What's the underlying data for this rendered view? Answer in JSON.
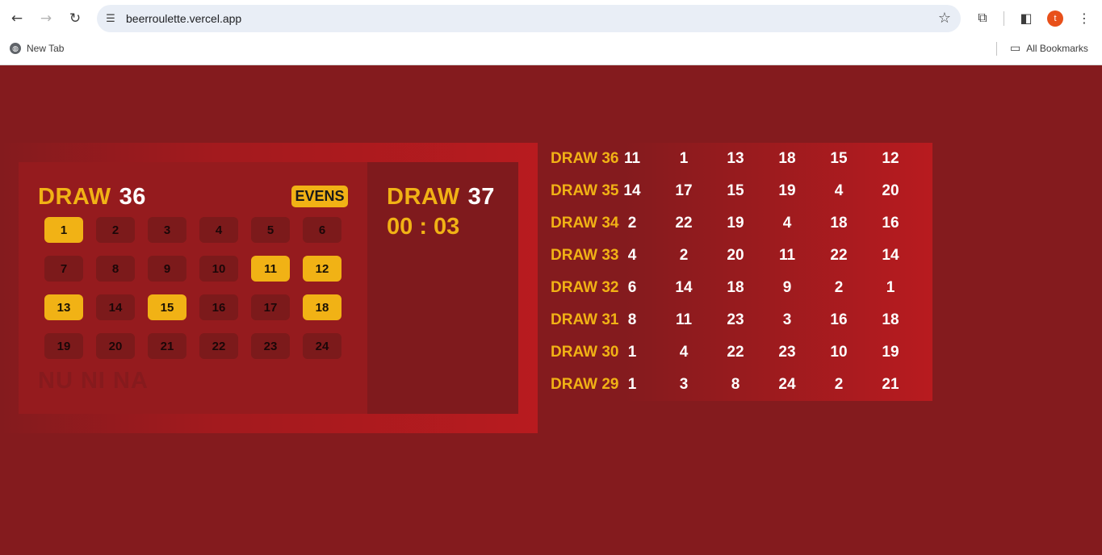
{
  "browser": {
    "url": "beerroulette.vercel.app",
    "bookmarks": [
      {
        "label": "New Tab"
      }
    ],
    "all_bookmarks_label": "All Bookmarks",
    "profile_initial": "t",
    "icons": {
      "back": "←",
      "forward": "→",
      "reload": "↻",
      "site_info": "☰",
      "star": "☆",
      "extensions": "⧉",
      "sidebar": "◧",
      "menu": "⋮",
      "globe": "◍",
      "folder": "▭"
    }
  },
  "current_draw": {
    "label": "DRAW",
    "number": "36",
    "badge": "EVENS",
    "footer_text": "NU NI NA",
    "numbers": [
      {
        "n": "1",
        "hit": true
      },
      {
        "n": "2",
        "hit": false
      },
      {
        "n": "3",
        "hit": false
      },
      {
        "n": "4",
        "hit": false
      },
      {
        "n": "5",
        "hit": false
      },
      {
        "n": "6",
        "hit": false
      },
      {
        "n": "7",
        "hit": false
      },
      {
        "n": "8",
        "hit": false
      },
      {
        "n": "9",
        "hit": false
      },
      {
        "n": "10",
        "hit": false
      },
      {
        "n": "11",
        "hit": true
      },
      {
        "n": "12",
        "hit": true
      },
      {
        "n": "13",
        "hit": true
      },
      {
        "n": "14",
        "hit": false
      },
      {
        "n": "15",
        "hit": true
      },
      {
        "n": "16",
        "hit": false
      },
      {
        "n": "17",
        "hit": false
      },
      {
        "n": "18",
        "hit": true
      },
      {
        "n": "19",
        "hit": false
      },
      {
        "n": "20",
        "hit": false
      },
      {
        "n": "21",
        "hit": false
      },
      {
        "n": "22",
        "hit": false
      },
      {
        "n": "23",
        "hit": false
      },
      {
        "n": "24",
        "hit": false
      }
    ]
  },
  "next_draw": {
    "label": "DRAW",
    "number": "37",
    "countdown": "00 : 03"
  },
  "history": [
    {
      "label": "DRAW 36",
      "values": [
        "11",
        "1",
        "13",
        "18",
        "15",
        "12"
      ]
    },
    {
      "label": "DRAW 35",
      "values": [
        "14",
        "17",
        "15",
        "19",
        "4",
        "20"
      ]
    },
    {
      "label": "DRAW 34",
      "values": [
        "2",
        "22",
        "19",
        "4",
        "18",
        "16"
      ]
    },
    {
      "label": "DRAW 33",
      "values": [
        "4",
        "2",
        "20",
        "11",
        "22",
        "14"
      ]
    },
    {
      "label": "DRAW 32",
      "values": [
        "6",
        "14",
        "18",
        "9",
        "2",
        "1"
      ]
    },
    {
      "label": "DRAW 31",
      "values": [
        "8",
        "11",
        "23",
        "3",
        "16",
        "18"
      ]
    },
    {
      "label": "DRAW 30",
      "values": [
        "1",
        "4",
        "22",
        "23",
        "10",
        "19"
      ]
    },
    {
      "label": "DRAW 29",
      "values": [
        "1",
        "3",
        "8",
        "24",
        "2",
        "21"
      ]
    }
  ],
  "colors": {
    "page_bg": "#841b1e",
    "accent_yellow": "#f1b215",
    "cell_off": "#7c1a1b",
    "text_white": "#ffffff"
  }
}
